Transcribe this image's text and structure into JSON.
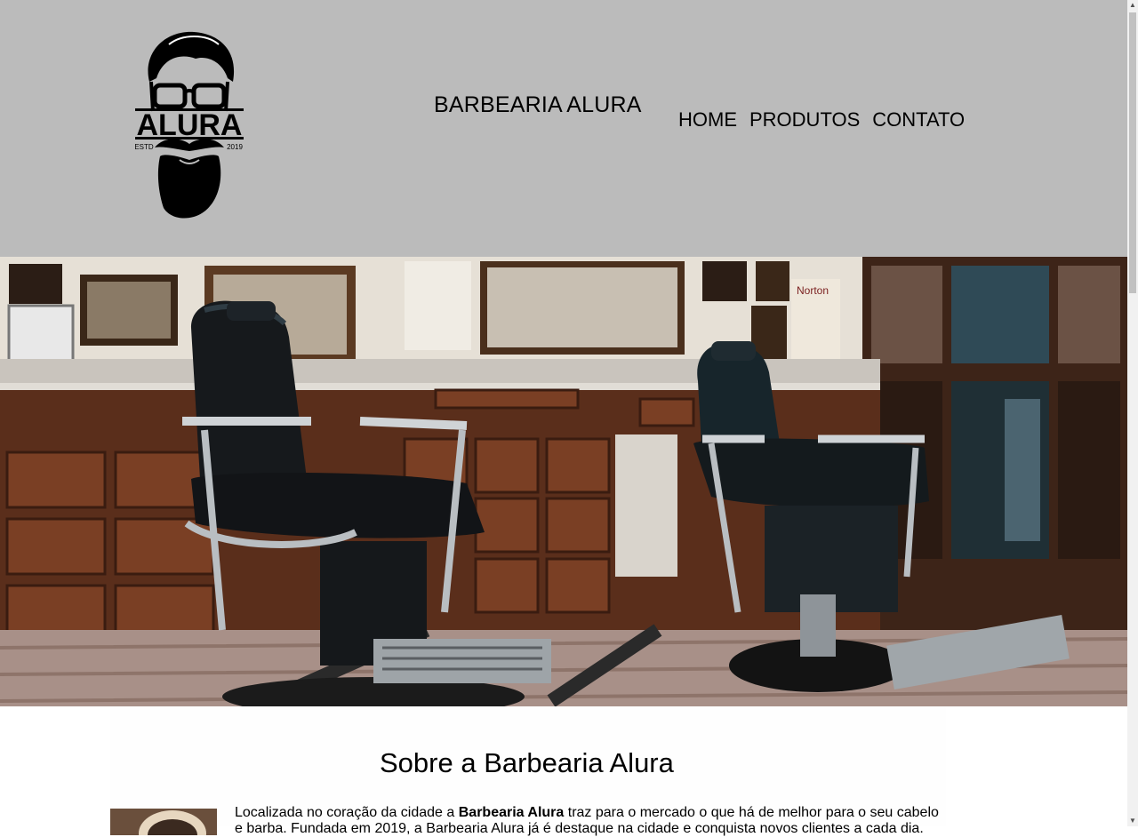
{
  "header": {
    "logo": {
      "text": "ALURA",
      "estd": "ESTD",
      "year": "2019"
    },
    "title": "BARBEARIA ALURA",
    "nav": [
      "HOME",
      "PRODUTOS",
      "CONTATO"
    ]
  },
  "hero": {
    "sign_text": "Norton"
  },
  "about": {
    "title": "Sobre a Barbearia Alura",
    "text_before": "Localizada no coração da cidade a ",
    "brand": "Barbearia Alura",
    "text_after": " traz para o mercado o que há de melhor para o seu cabelo e barba. Fundada em 2019, a Barbearia Alura já é destaque na cidade e conquista novos clientes a cada dia."
  },
  "colors": {
    "header_bg": "#bbbbbb",
    "text": "#000000"
  },
  "icons": [
    "scroll-up-icon",
    "scroll-down-icon"
  ]
}
